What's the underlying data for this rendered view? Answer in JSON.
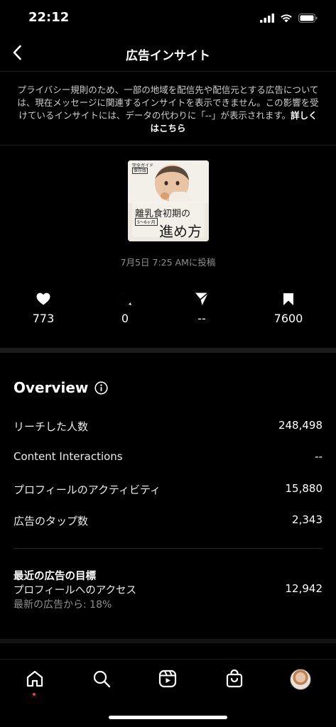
{
  "status_bar": {
    "time": "22:12"
  },
  "header": {
    "title": "広告インサイト"
  },
  "notice": {
    "text": "プライバシー規則のため、一部の地域を配信先や配信元とする広告については、現在メッセージに関連するインサイトを表示できません。この影響を受けているインサイトには、データの代わりに「--」が表示されます。",
    "link": "詳しくはこちら"
  },
  "post": {
    "thumbnail_text": {
      "tag": "完全ガイド",
      "tag2": "保存版",
      "title": "離乳食初期の",
      "title2": "進め方",
      "range": "5〜6ヶ月"
    },
    "date": "7月5日 7:25 AMに投稿"
  },
  "stats": {
    "likes": "773",
    "comments": "0",
    "shares": "--",
    "saves": "7600"
  },
  "overview": {
    "title": "Overview",
    "rows": [
      {
        "label": "リーチした人数",
        "value": "248,498"
      },
      {
        "label": "Content Interactions",
        "value": "--"
      },
      {
        "label": "プロフィールのアクティビティ",
        "value": "15,880"
      },
      {
        "label": "広告のタップ数",
        "value": "2,343"
      }
    ]
  },
  "goal": {
    "title": "最近の広告の目標",
    "name": "プロフィールへのアクセス",
    "value": "12,942",
    "sub": "最新の広告から: 18%"
  },
  "tabs": {
    "icons": [
      "home-icon",
      "search-icon",
      "reels-icon",
      "shop-icon",
      "profile-avatar"
    ]
  },
  "colors": {
    "background": "#000000",
    "muted": "#8e8e8e",
    "notification_dot": "#ff3040"
  }
}
